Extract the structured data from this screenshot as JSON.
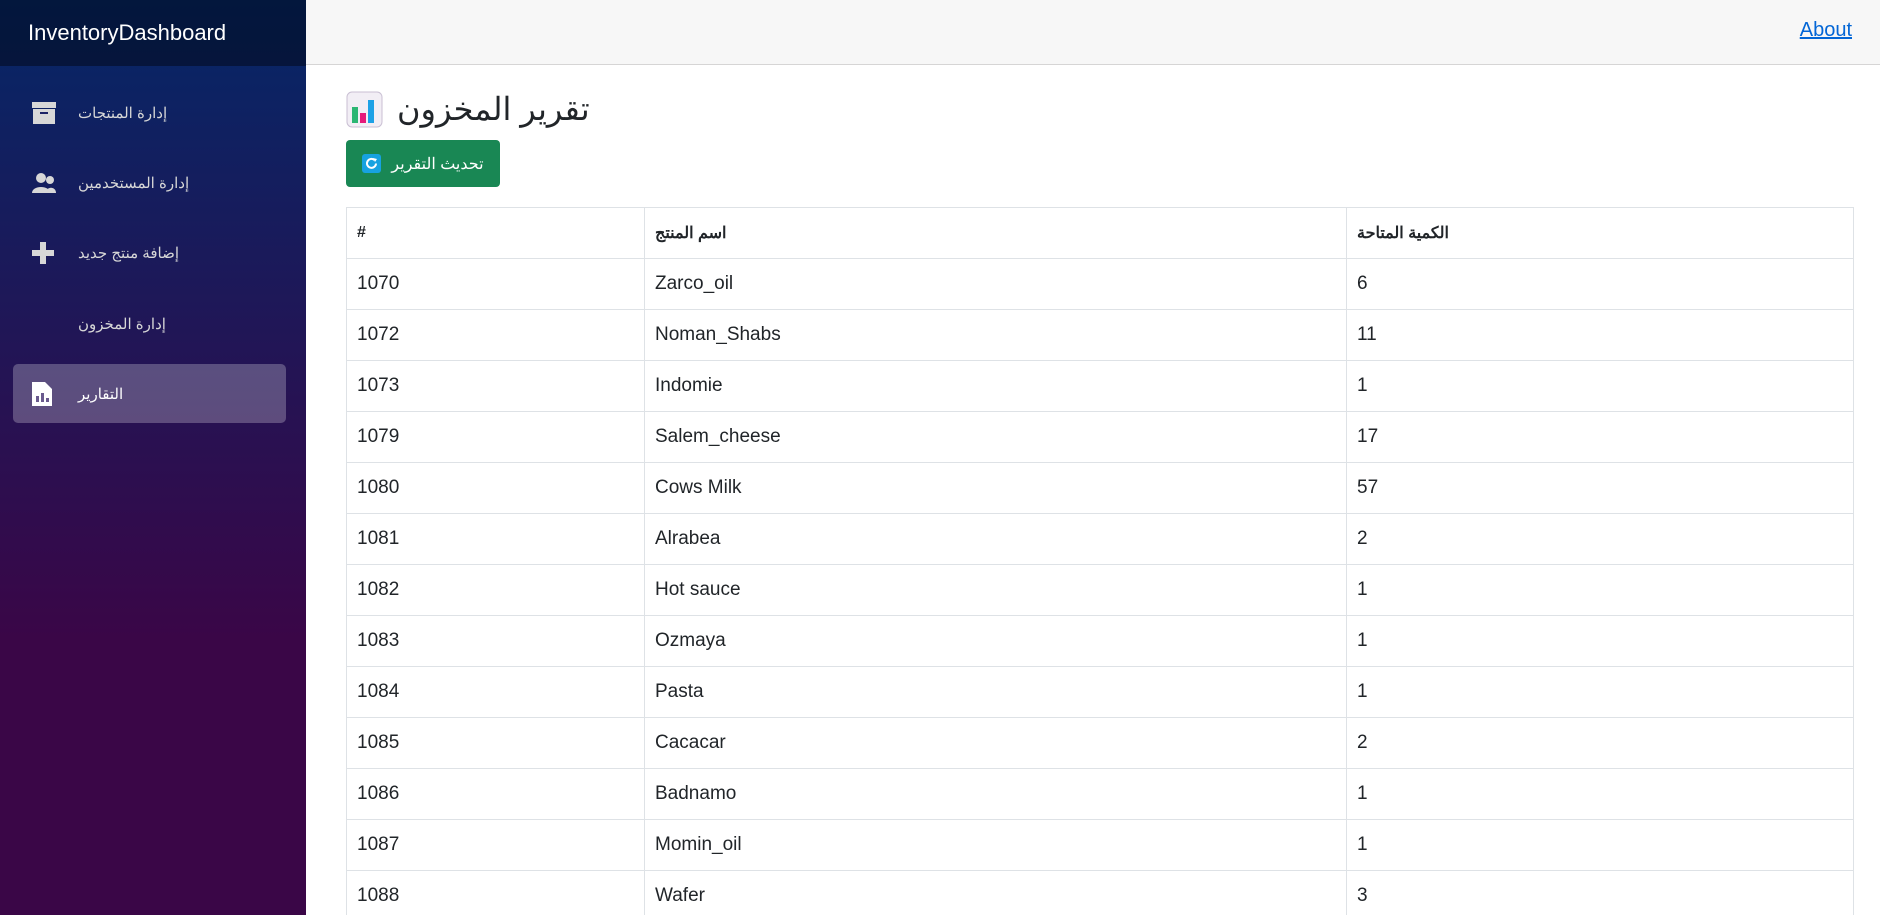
{
  "app": {
    "brand": "InventoryDashboard",
    "about": "About"
  },
  "sidebar": {
    "items": [
      {
        "label": "إدارة المنتجات",
        "icon": "archive-box-icon"
      },
      {
        "label": "إدارة المستخدمين",
        "icon": "users-icon"
      },
      {
        "label": "إضافة منتج جديد",
        "icon": "plus-icon"
      },
      {
        "label": "إدارة المخزون",
        "icon": ""
      },
      {
        "label": "التقارير",
        "icon": "report-document-icon",
        "active": true
      }
    ]
  },
  "main": {
    "title": "تقرير المخزون",
    "refresh_label": "تحديث التقرير",
    "table": {
      "headers": [
        "#",
        "اسم المنتج",
        "الكمية المتاحة"
      ],
      "rows": [
        [
          "1070",
          "Zarco_oil",
          "6"
        ],
        [
          "1072",
          "Noman_Shabs",
          "11"
        ],
        [
          "1073",
          "Indomie",
          "1"
        ],
        [
          "1079",
          "Salem_cheese",
          "17"
        ],
        [
          "1080",
          "Cows Milk",
          "57"
        ],
        [
          "1081",
          "Alrabea",
          "2"
        ],
        [
          "1082",
          "Hot sauce",
          "1"
        ],
        [
          "1083",
          "Ozmaya",
          "1"
        ],
        [
          "1084",
          "Pasta",
          "1"
        ],
        [
          "1085",
          "Cacacar",
          "2"
        ],
        [
          "1086",
          "Badnamo",
          "1"
        ],
        [
          "1087",
          "Momin_oil",
          "1"
        ],
        [
          "1088",
          "Wafer",
          "3"
        ]
      ]
    }
  },
  "colors": {
    "accent_green": "#198754",
    "link": "#0366d6",
    "sidebar_top": "#052767",
    "sidebar_bottom": "#3a0647"
  }
}
